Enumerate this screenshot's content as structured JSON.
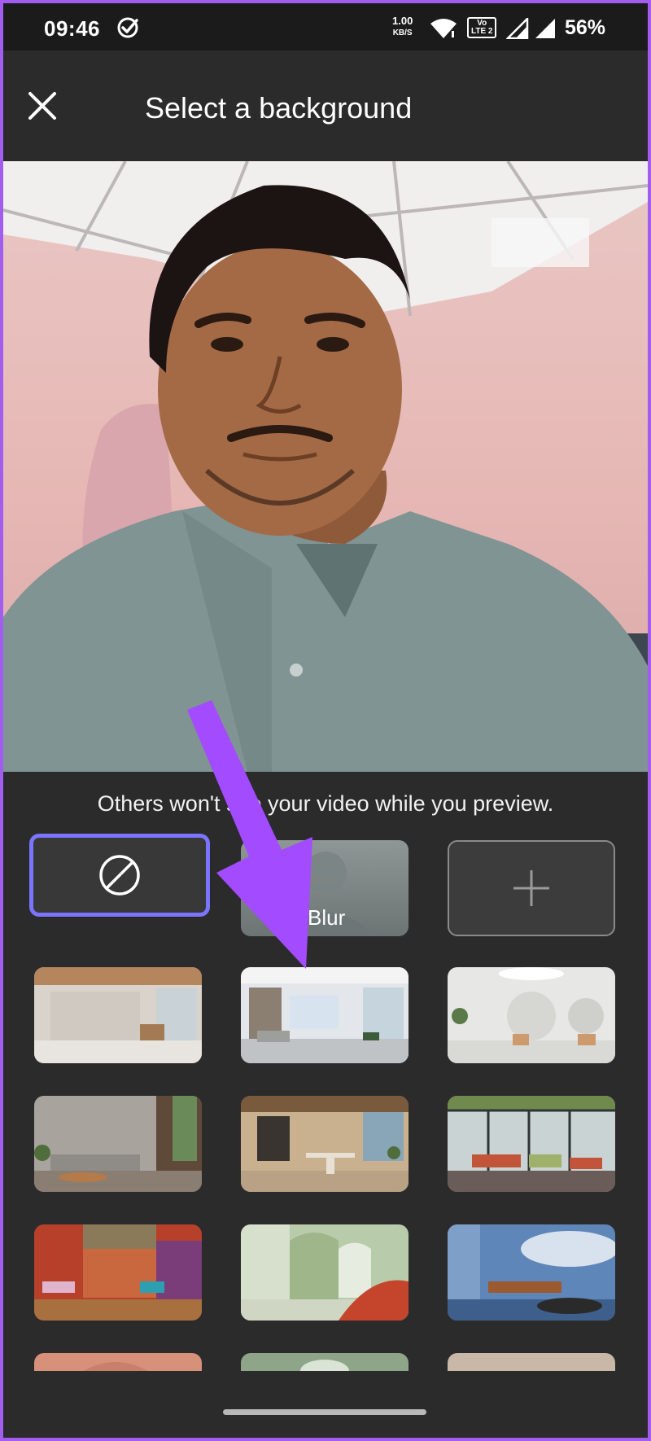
{
  "status_bar": {
    "time": "09:46",
    "speed_value": "1.00",
    "speed_unit": "KB/S",
    "volte_top": "Vo",
    "volte_bottom": "LTE 2",
    "battery": "56%"
  },
  "header": {
    "title": "Select a background"
  },
  "preview": {
    "note": "Others won't see your video while you preview."
  },
  "backgrounds": {
    "blur_label": "Blur"
  },
  "colors": {
    "accent": "#7b74ff",
    "arrow": "#a24bff",
    "panel": "#2b2b2b",
    "statusbar": "#1b1b1b"
  },
  "icons": [
    "check-circle-icon",
    "wifi-icon",
    "signal-icon",
    "close-icon",
    "no-background-icon",
    "plus-icon"
  ]
}
